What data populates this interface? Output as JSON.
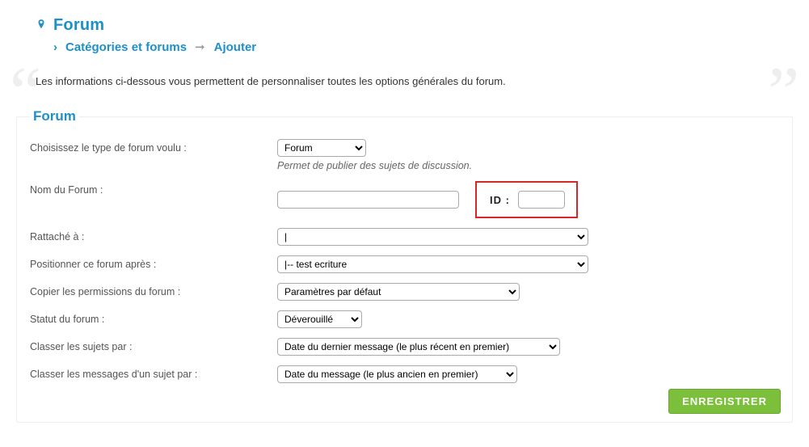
{
  "header": {
    "title": "Forum",
    "breadcrumb1": "Catégories et forums",
    "breadcrumb2": "Ajouter"
  },
  "intro": "Les informations ci-dessous vous permettent de personnaliser toutes les options générales du forum.",
  "legend": "Forum",
  "fields": {
    "type": {
      "label": "Choisissez le type de forum voulu :",
      "value": "Forum",
      "help": "Permet de publier des sujets de discussion."
    },
    "name": {
      "label": "Nom du Forum :",
      "value": "",
      "id_label": "ID :",
      "id_value": ""
    },
    "parent": {
      "label": "Rattaché à :",
      "value": "|"
    },
    "position": {
      "label": "Positionner ce forum après :",
      "value": "|-- test ecriture"
    },
    "permissions": {
      "label": "Copier les permissions du forum :",
      "value": "Paramètres par défaut"
    },
    "status": {
      "label": "Statut du forum :",
      "value": "Déverouillé"
    },
    "sort_subjects": {
      "label": "Classer les sujets par :",
      "value": "Date du dernier message (le plus récent en premier)"
    },
    "sort_messages": {
      "label": "Classer les messages d'un sujet par :",
      "value": "Date du message (le plus ancien en premier)"
    }
  },
  "save_label": "ENREGISTRER"
}
